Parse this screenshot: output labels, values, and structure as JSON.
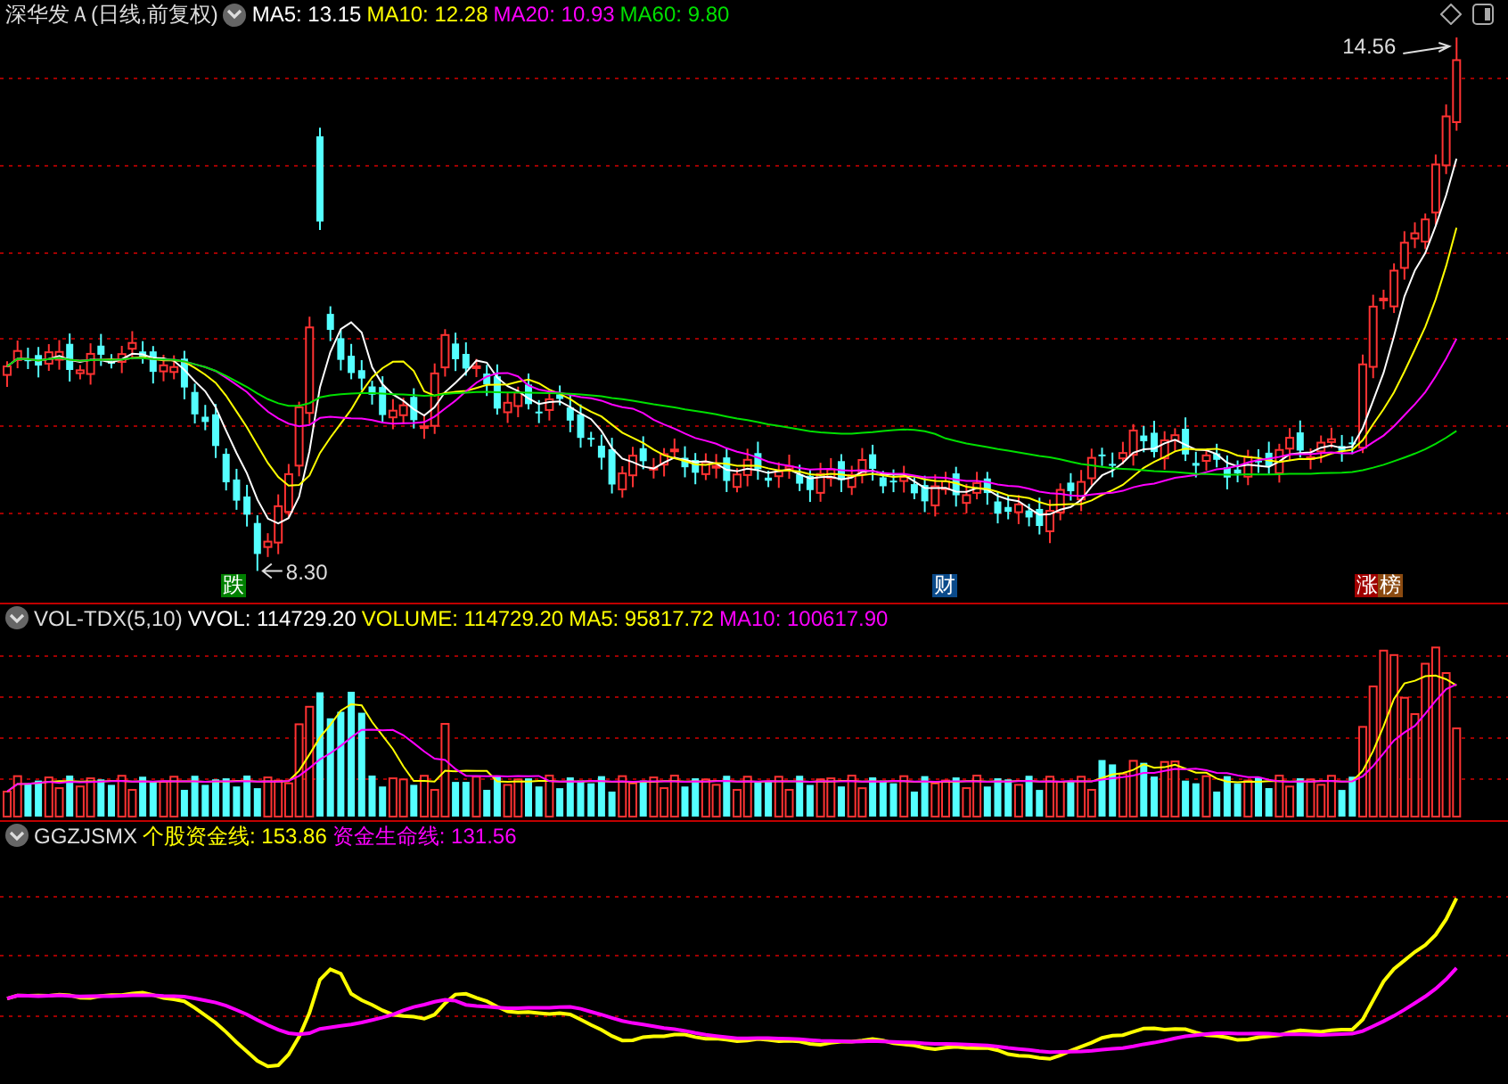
{
  "price_panel": {
    "title": "深华发Ａ(日线,前复权)",
    "indicators": [
      {
        "label": "MA5: 13.15",
        "color": "#ffffff"
      },
      {
        "label": "MA10: 12.28",
        "color": "#ffff00"
      },
      {
        "label": "MA20: 10.93",
        "color": "#ff00ff"
      },
      {
        "label": "MA60: 9.80",
        "color": "#00e000"
      }
    ],
    "high_label": "14.56",
    "low_label": "8.30",
    "markers": [
      {
        "text": "跌",
        "color": "#008000"
      },
      {
        "text": "财",
        "color": "#0a4a8a"
      },
      {
        "text": "涨",
        "color": "#a00000"
      },
      {
        "text": "榜",
        "color": "#8b4a10"
      }
    ]
  },
  "volume_panel": {
    "name": "VOL-TDX(5,10)",
    "indicators": [
      {
        "label": "VVOL: 114729.20",
        "color": "#ffffff"
      },
      {
        "label": "VOLUME: 114729.20",
        "color": "#ffff00"
      },
      {
        "label": "MA5: 95817.72",
        "color": "#ffff00"
      },
      {
        "label": "MA10: 100617.90",
        "color": "#ff00ff"
      }
    ]
  },
  "indicator_panel": {
    "name": "GGZJSMX",
    "indicators": [
      {
        "label": "个股资金线: 153.86",
        "color": "#ffff00"
      },
      {
        "label": "资金生命线: 131.56",
        "color": "#ff00ff"
      }
    ]
  }
}
